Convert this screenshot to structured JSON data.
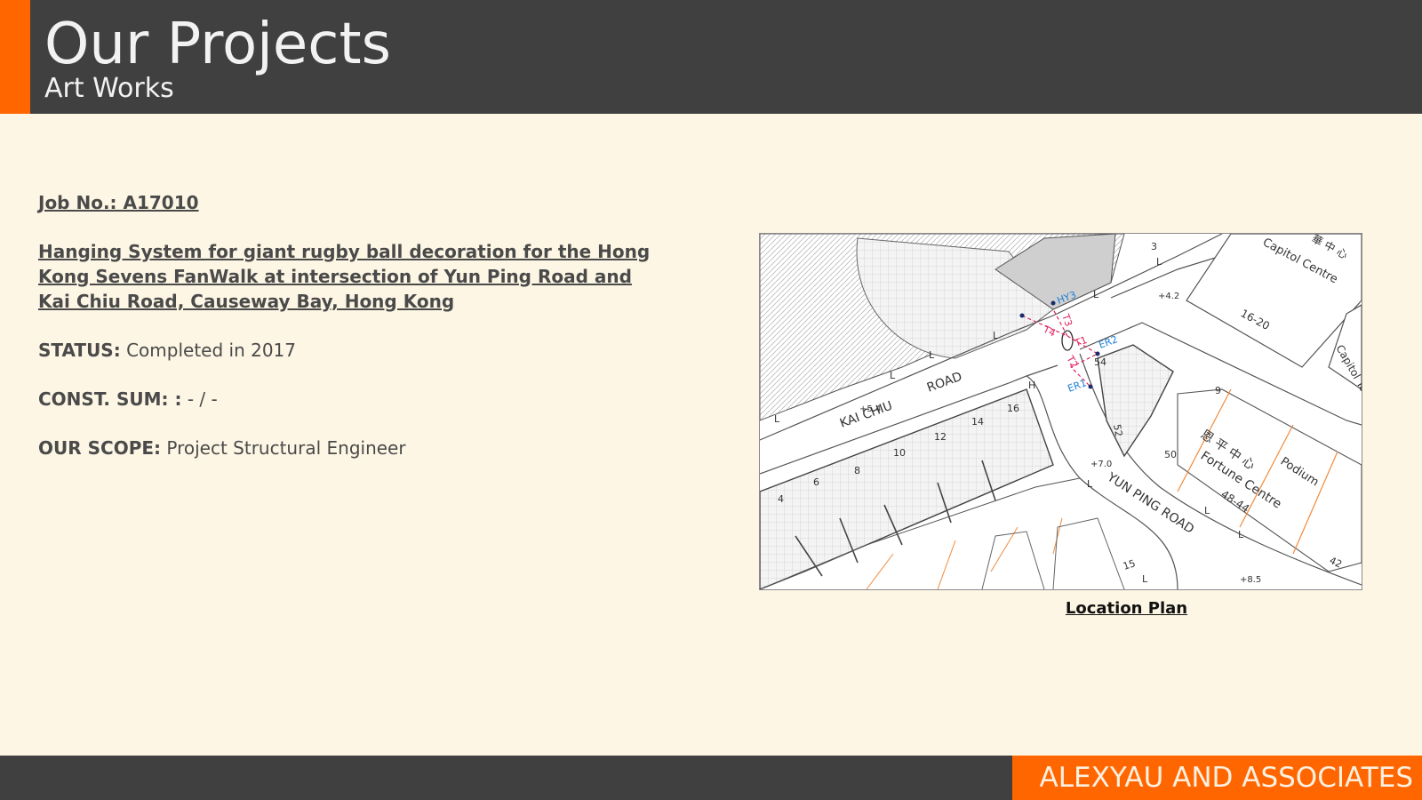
{
  "header": {
    "title": "Our Projects",
    "subtitle": "Art Works"
  },
  "project": {
    "job_no": "Job No.: A17010",
    "description": "Hanging System for giant rugby ball decoration for the Hong Kong Sevens FanWalk at intersection of Yun Ping Road and Kai Chiu Road, Causeway Bay, Hong Kong",
    "status_label": "STATUS:",
    "status_value": "Completed in 2017",
    "const_sum_label": "CONST. SUM: :",
    "const_sum_value": "- / -",
    "scope_label": "OUR SCOPE:",
    "scope_value": "Project Structural Engineer"
  },
  "plan": {
    "caption": "Location Plan",
    "labels": {
      "kai_chiu": "KAI CHIU",
      "road1": "ROAD",
      "yun_ping": "YUN PING ROAD",
      "capitol": "Capitol Centre",
      "capitol_cn": "華 中 心",
      "fortune": "Fortune Centre",
      "fortune_cn": "恩 平 中 心",
      "podium": "Podium",
      "capitol_tower": "Capitol Tower",
      "num_48_44": "48-44",
      "num_16_20": "16-20",
      "num_50": "50",
      "num_52": "52",
      "num_54": "54",
      "num_9": "9",
      "num_15": "15",
      "num_42": "42",
      "num_3": "3",
      "num_4": "4",
      "num_6": "6",
      "num_8": "8",
      "num_10": "10",
      "num_12": "12",
      "num_14": "14",
      "num_16": "16",
      "hy3": "HY3",
      "er2": "ER2",
      "er1": "ER1",
      "t1": "T1",
      "t2": "T2",
      "t3": "T3",
      "t4": "T4",
      "lvl_4_2": "+4.2",
      "lvl_5_4": "+5.4",
      "lvl_7_0": "+7.0",
      "lvl_8_5": "+8.5",
      "l": "L",
      "h": "H"
    }
  },
  "footer": {
    "brand": "ALEXYAU AND ASSOCIATES"
  },
  "colors": {
    "header_bg": "#404040",
    "accent": "#ff6600",
    "page_bg": "#fdf6e4",
    "annotation_red": "#e0245e",
    "annotation_blue": "#1e7fd6",
    "boundary_orange": "#f08a3c"
  }
}
